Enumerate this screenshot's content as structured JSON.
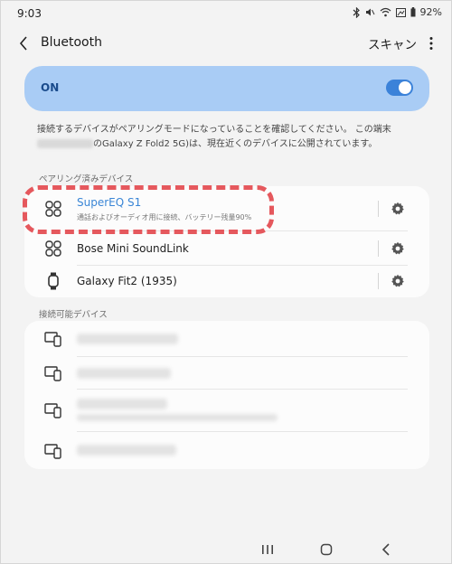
{
  "status_bar": {
    "time": "9:03",
    "battery": "92%",
    "icons": [
      "bluetooth-icon",
      "mute-icon",
      "wifi-icon",
      "gallery-icon",
      "battery-icon"
    ]
  },
  "header": {
    "title": "Bluetooth",
    "scan_label": "スキャン",
    "back_icon": "chevron-left-icon",
    "more_icon": "more-vertical-icon"
  },
  "toggle_card": {
    "label": "ON",
    "enabled": true
  },
  "description": {
    "text_part1": "接続するデバイスがペアリングモードになっていることを確認してください。 この端末",
    "text_part2": "のGalaxy Z Fold2 5G)は、現在近くのデバイスに公開されています。"
  },
  "paired_section": {
    "label": "ペアリング済みデバイス",
    "devices": [
      {
        "name": "SuperEQ S1",
        "status": "通話およびオーディオ用に接続、バッテリー残量90%",
        "icon": "earbuds-icon",
        "active": true
      },
      {
        "name": "Bose Mini SoundLink",
        "icon": "speaker-icon",
        "active": false
      },
      {
        "name": "Galaxy Fit2 (1935)",
        "icon": "watch-icon",
        "active": false
      }
    ]
  },
  "available_section": {
    "label": "接続可能デバイス",
    "device_icon": "devices-icon"
  },
  "nav": {
    "recent_icon": "recent-apps-icon",
    "home_icon": "home-icon",
    "back_icon": "back-icon"
  },
  "colors": {
    "toggle_card_bg": "#a9ccf5",
    "accent": "#3b82d9",
    "active_device_text": "#3a86d6",
    "highlight": "#e5585d"
  }
}
